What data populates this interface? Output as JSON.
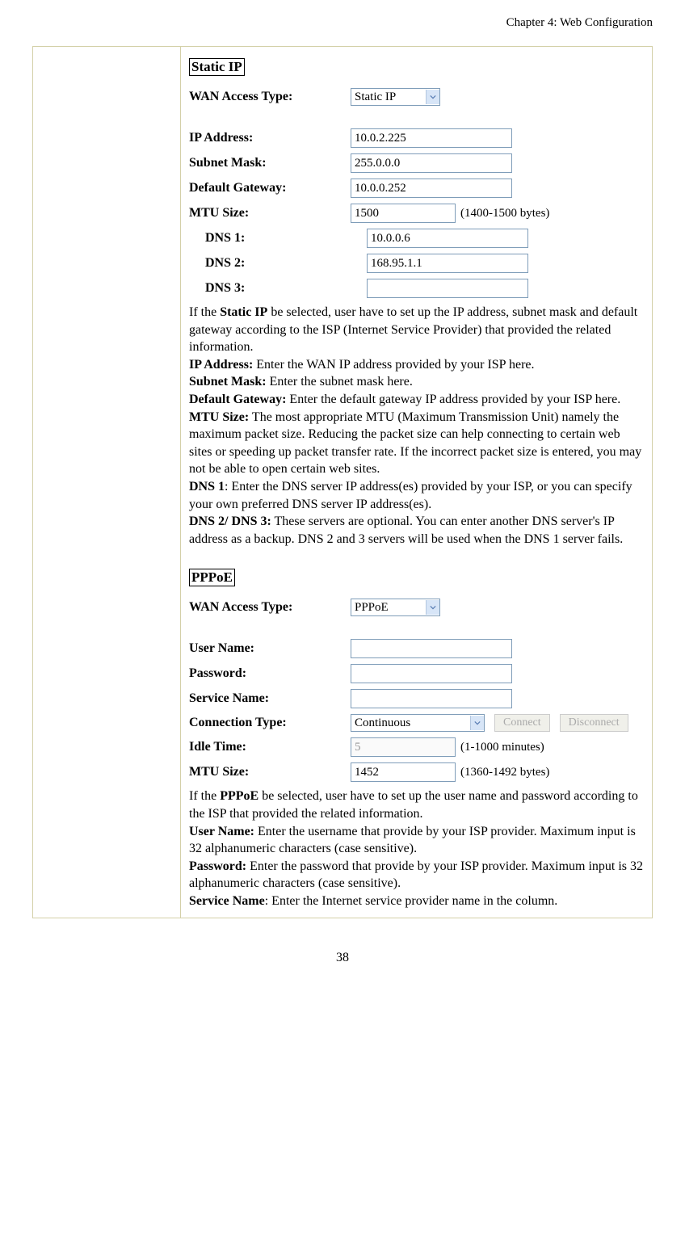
{
  "header": {
    "chapter": "Chapter 4: Web Configuration"
  },
  "staticIP": {
    "heading": "Static IP",
    "fields": {
      "wanAccessType": {
        "label": "WAN Access Type:",
        "value": "Static IP"
      },
      "ipAddress": {
        "label": "IP Address:",
        "value": "10.0.2.225"
      },
      "subnetMask": {
        "label": "Subnet Mask:",
        "value": "255.0.0.0"
      },
      "defaultGateway": {
        "label": "Default Gateway:",
        "value": "10.0.0.252"
      },
      "mtuSize": {
        "label": "MTU Size:",
        "value": "1500",
        "hint": "(1400-1500 bytes)"
      },
      "dns1": {
        "label": "DNS 1:",
        "value": "10.0.0.6"
      },
      "dns2": {
        "label": "DNS 2:",
        "value": "168.95.1.1"
      },
      "dns3": {
        "label": "DNS 3:",
        "value": ""
      }
    },
    "desc": {
      "intro_a": "If the ",
      "intro_b_bold": "Static IP",
      "intro_c": " be selected, user have to set up the IP address, subnet mask and default gateway according to the ISP (Internet Service Provider) that provided the related information.",
      "ipAddress_label": "IP Address:",
      "ipAddress_text": " Enter the WAN IP address provided by your ISP here.",
      "subnetMask_label": "Subnet Mask:",
      "subnetMask_text": " Enter the subnet mask here.",
      "defaultGateway_label": "Default Gateway:",
      "defaultGateway_text": " Enter the default gateway IP address provided by your ISP here.",
      "mtu_label": "MTU Size:",
      "mtu_text": " The most appropriate MTU (Maximum Transmission Unit) namely the maximum packet size. Reducing the packet size can help connecting to certain web sites or speeding up packet transfer rate. If the incorrect packet size is entered, you may not be able to open certain web sites.",
      "dns1_label": "DNS 1",
      "dns1_text": ": Enter the DNS server IP address(es) provided by your ISP, or you can specify your own preferred DNS server IP address(es).",
      "dns23_label": "DNS 2/ DNS 3:",
      "dns23_text": " These servers are optional. You can enter another DNS server's IP address as a backup. DNS 2 and 3 servers will be used when the DNS 1 server fails."
    }
  },
  "pppoe": {
    "heading": "PPPoE",
    "fields": {
      "wanAccessType": {
        "label": "WAN Access Type:",
        "value": "PPPoE"
      },
      "userName": {
        "label": "User Name:",
        "value": ""
      },
      "password": {
        "label": "Password:",
        "value": ""
      },
      "serviceName": {
        "label": "Service Name:",
        "value": ""
      },
      "connectionType": {
        "label": "Connection Type:",
        "value": "Continuous",
        "btnConnect": "Connect",
        "btnDisconnect": "Disconnect"
      },
      "idleTime": {
        "label": "Idle Time:",
        "value": "5",
        "hint": "(1-1000 minutes)"
      },
      "mtuSize": {
        "label": "MTU Size:",
        "value": "1452",
        "hint": "(1360-1492 bytes)"
      }
    },
    "desc": {
      "intro_a": "If the ",
      "intro_b_bold": "PPPoE",
      "intro_c": " be selected, user have to set up the user name and password according to the ISP that provided the related information.",
      "user_label": "User Name:",
      "user_text": " Enter the username that provide by your ISP provider. Maximum input is 32 alphanumeric characters (case sensitive).",
      "pass_label": "Password:",
      "pass_text": " Enter the password that provide by your ISP provider. Maximum input is 32 alphanumeric characters (case sensitive).",
      "service_label": "Service Name",
      "service_text": ": Enter the Internet service provider name in the column."
    }
  },
  "pageNumber": "38"
}
